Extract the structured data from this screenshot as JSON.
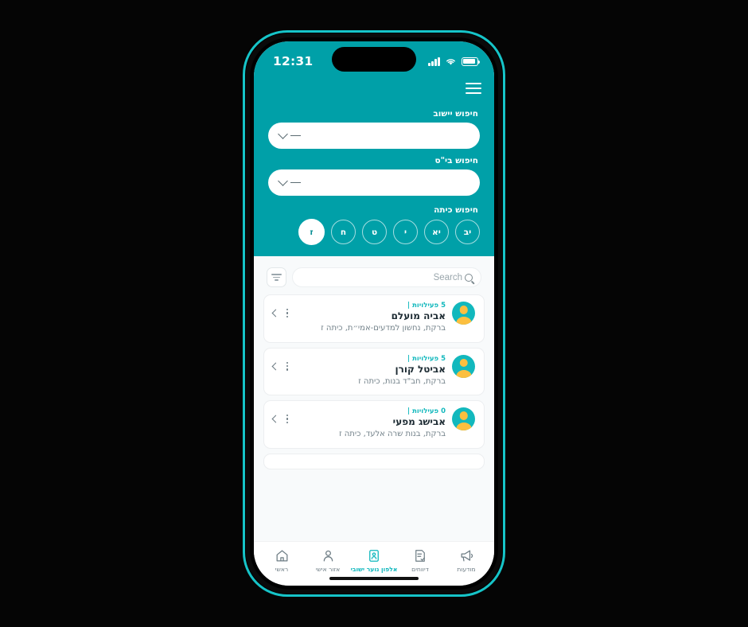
{
  "theme": {
    "teal": "#00a0a8",
    "teal_light": "#12b8bd",
    "avatar_yellow": "#fcbf3f",
    "bezel": "#16c4c8"
  },
  "status_bar": {
    "time": "12:31",
    "signal_icon": "signal-bars-icon",
    "wifi_icon": "wifi-icon",
    "battery_icon": "battery-icon"
  },
  "header": {
    "menu_icon": "hamburger-menu-icon",
    "fields": [
      {
        "label": "חיפוש יישוב",
        "value": "—",
        "chevron_icon": "chevron-down-icon"
      },
      {
        "label": "חיפוש בי\"ס",
        "value": "—",
        "chevron_icon": "chevron-down-icon"
      }
    ],
    "class_filter": {
      "label": "חיפוש כיתה",
      "chips": [
        {
          "label": "יב",
          "active": false
        },
        {
          "label": "יא",
          "active": false
        },
        {
          "label": "י",
          "active": false
        },
        {
          "label": "ט",
          "active": false
        },
        {
          "label": "ח",
          "active": false
        },
        {
          "label": "ז",
          "active": true
        }
      ]
    }
  },
  "search": {
    "filter_icon": "filter-icon",
    "placeholder": "Search",
    "value": "",
    "search_icon": "search-icon"
  },
  "list": {
    "items": [
      {
        "name": "אביה מועלם",
        "activities": "5 פעילויות |",
        "details": "ברקת, נחשון למדעים-אמי״ת, כיתה ז",
        "avatar_icon": "user-avatar-icon",
        "more_icon": "more-vertical-icon",
        "chevron_icon": "chevron-left-icon"
      },
      {
        "name": "אביטל קורן",
        "activities": "5 פעילויות |",
        "details": "ברקת, חב\"ד בנות, כיתה ז",
        "avatar_icon": "user-avatar-icon",
        "more_icon": "more-vertical-icon",
        "chevron_icon": "chevron-left-icon"
      },
      {
        "name": "אבישג מפעי",
        "activities": "0 פעילויות |",
        "details": "ברקת, בנות שרה אלעד, כיתה ז",
        "avatar_icon": "user-avatar-icon",
        "more_icon": "more-vertical-icon",
        "chevron_icon": "chevron-left-icon"
      }
    ]
  },
  "tabbar": {
    "tabs": [
      {
        "label": "ראשי",
        "icon": "home-icon",
        "active": false
      },
      {
        "label": "אזור אישי",
        "icon": "person-icon",
        "active": false
      },
      {
        "label": "אלפון נוער ישובי",
        "icon": "id-card-icon",
        "active": true
      },
      {
        "label": "דיווחים",
        "icon": "report-document-icon",
        "active": false
      },
      {
        "label": "מודעות",
        "icon": "megaphone-icon",
        "active": false
      }
    ]
  }
}
